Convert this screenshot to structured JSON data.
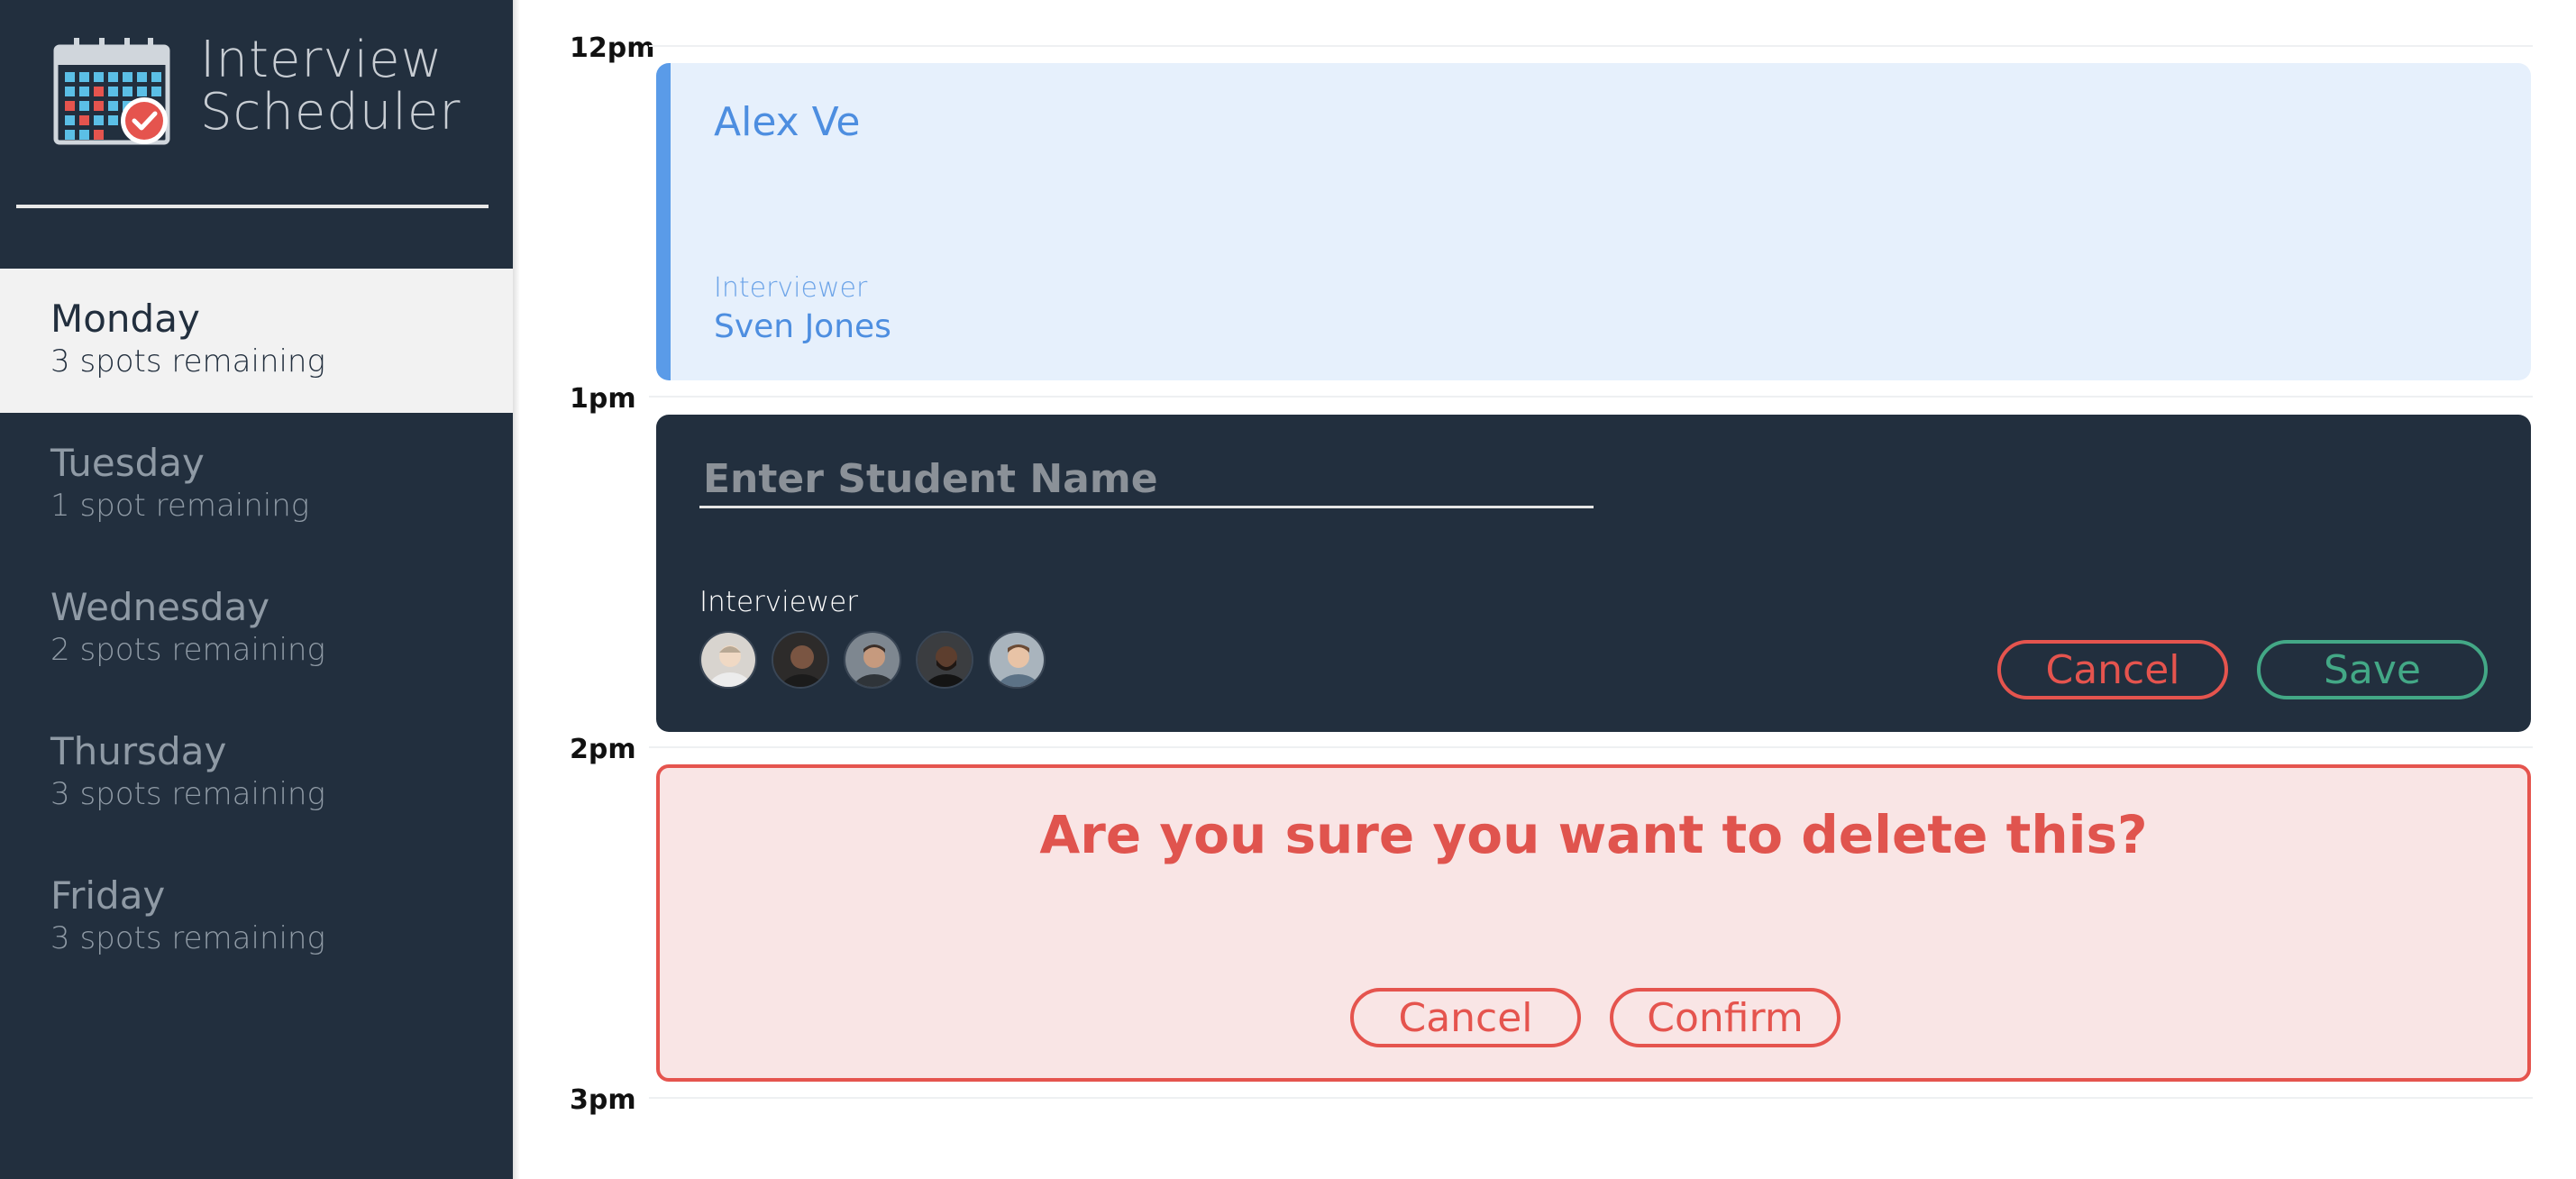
{
  "app": {
    "title_line1": "Interview",
    "title_line2": "Scheduler",
    "logo_icon": "calendar-check-icon"
  },
  "days": [
    {
      "name": "Monday",
      "spots": "3 spots remaining",
      "selected": true
    },
    {
      "name": "Tuesday",
      "spots": "1 spot remaining",
      "selected": false
    },
    {
      "name": "Wednesday",
      "spots": "2 spots remaining",
      "selected": false
    },
    {
      "name": "Thursday",
      "spots": "3 spots remaining",
      "selected": false
    },
    {
      "name": "Friday",
      "spots": "3 spots remaining",
      "selected": false
    }
  ],
  "times": [
    "12pm",
    "1pm",
    "2pm",
    "3pm"
  ],
  "appointment": {
    "student": "Alex Ve",
    "interviewer_label": "Interviewer",
    "interviewer": "Sven Jones"
  },
  "form": {
    "placeholder": "Enter Student Name",
    "interviewer_label": "Interviewer",
    "interviewers": [
      "interviewer-avatar-1",
      "interviewer-avatar-2",
      "interviewer-avatar-3",
      "interviewer-avatar-4",
      "interviewer-avatar-5"
    ],
    "cancel_label": "Cancel",
    "save_label": "Save"
  },
  "confirm": {
    "message": "Are you sure you want to delete this?",
    "cancel_label": "Cancel",
    "confirm_label": "Confirm"
  },
  "colors": {
    "sidebar": "#222f3e",
    "accent_blue": "#5a9be8",
    "danger": "#e5544e",
    "success": "#43a886"
  }
}
